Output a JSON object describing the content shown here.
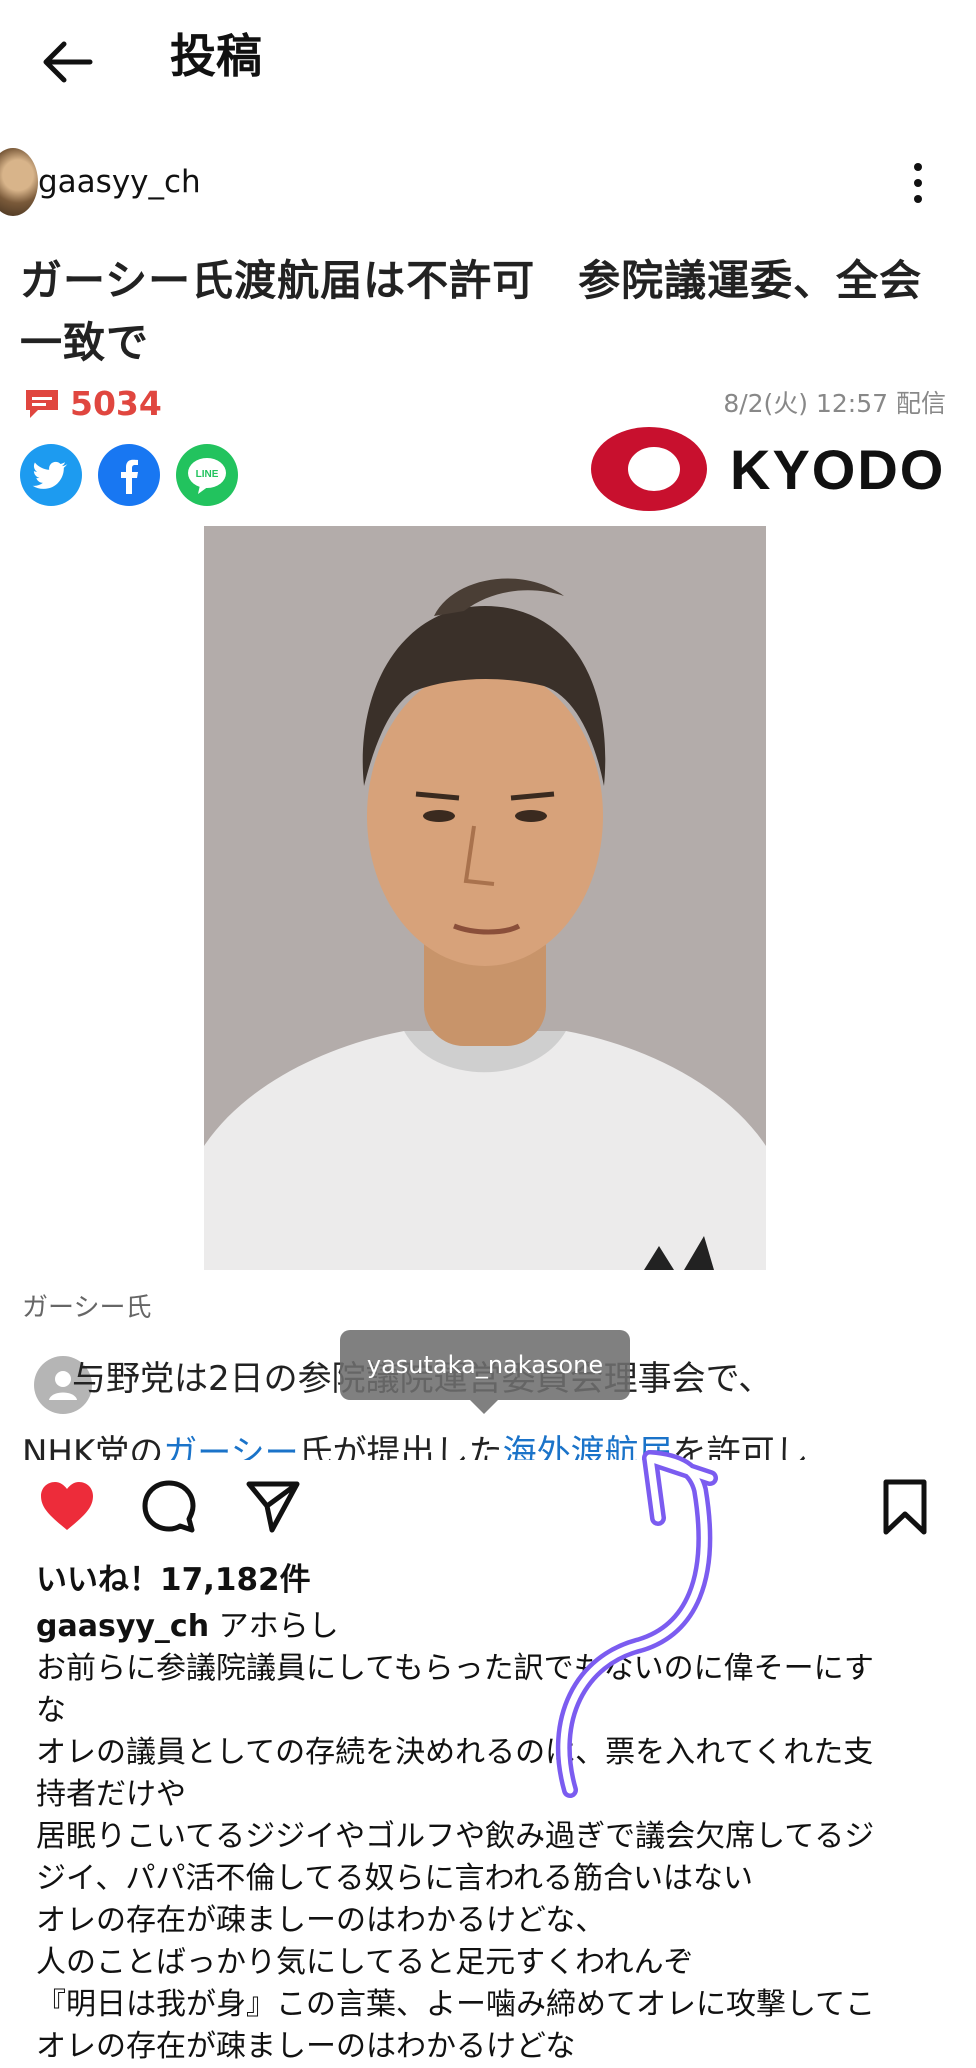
{
  "header": {
    "title": "投稿"
  },
  "author": {
    "username": "gaasyy_ch"
  },
  "article": {
    "headline": "ガーシー氏渡航届は不許可　参院議運委、全会一致で",
    "comment_count": "5034",
    "datetime": "8/2(火) 12:57 配信",
    "source": "KYODO",
    "photo_caption": "ガーシー氏",
    "body_line1": "与野党は2日の参院議院運営委員会理事会で、",
    "body_line2_pre": "NHK党の",
    "body_line2_link1": "ガーシー",
    "body_line2_mid": "氏が提出した",
    "body_line2_link2": "海外渡航届",
    "body_line2_post": "を許可し"
  },
  "tag": {
    "name": "yasutaka_nakasone"
  },
  "post": {
    "likes": "いいね！17,182件",
    "caption_user": "gaasyy_ch",
    "caption_lines": [
      "アホらし",
      "お前らに参議院議員にしてもらった訳でもないのに偉そーにす",
      "な",
      "オレの議員としての存続を決めれるのは、票を入れてくれた支",
      "持者だけや",
      "居眠りこいてるジジイやゴルフや飲み過ぎで議会欠席してるジ",
      "ジイ、パパ活不倫してる奴らに言われる筋合いはない",
      "オレの存在が疎ましーのはわかるけどな、",
      "人のことばっかり気にしてると足元すくわれんぞ",
      "『明日は我が身』この言葉、よー噛み締めてオレに攻撃してこ",
      "オレの存在が疎ましーのはわかるけどな"
    ]
  },
  "colors": {
    "accent_red": "#e0463f",
    "like_red": "#ed2c3a",
    "link_blue": "#1a73c9",
    "annotation_purple": "#7b5cf0"
  },
  "icons": [
    "back-arrow-icon",
    "more-vertical-icon",
    "comment-icon",
    "twitter-icon",
    "facebook-icon",
    "line-icon",
    "heart-icon",
    "comment-bubble-icon",
    "share-icon",
    "bookmark-icon",
    "person-tag-icon"
  ]
}
